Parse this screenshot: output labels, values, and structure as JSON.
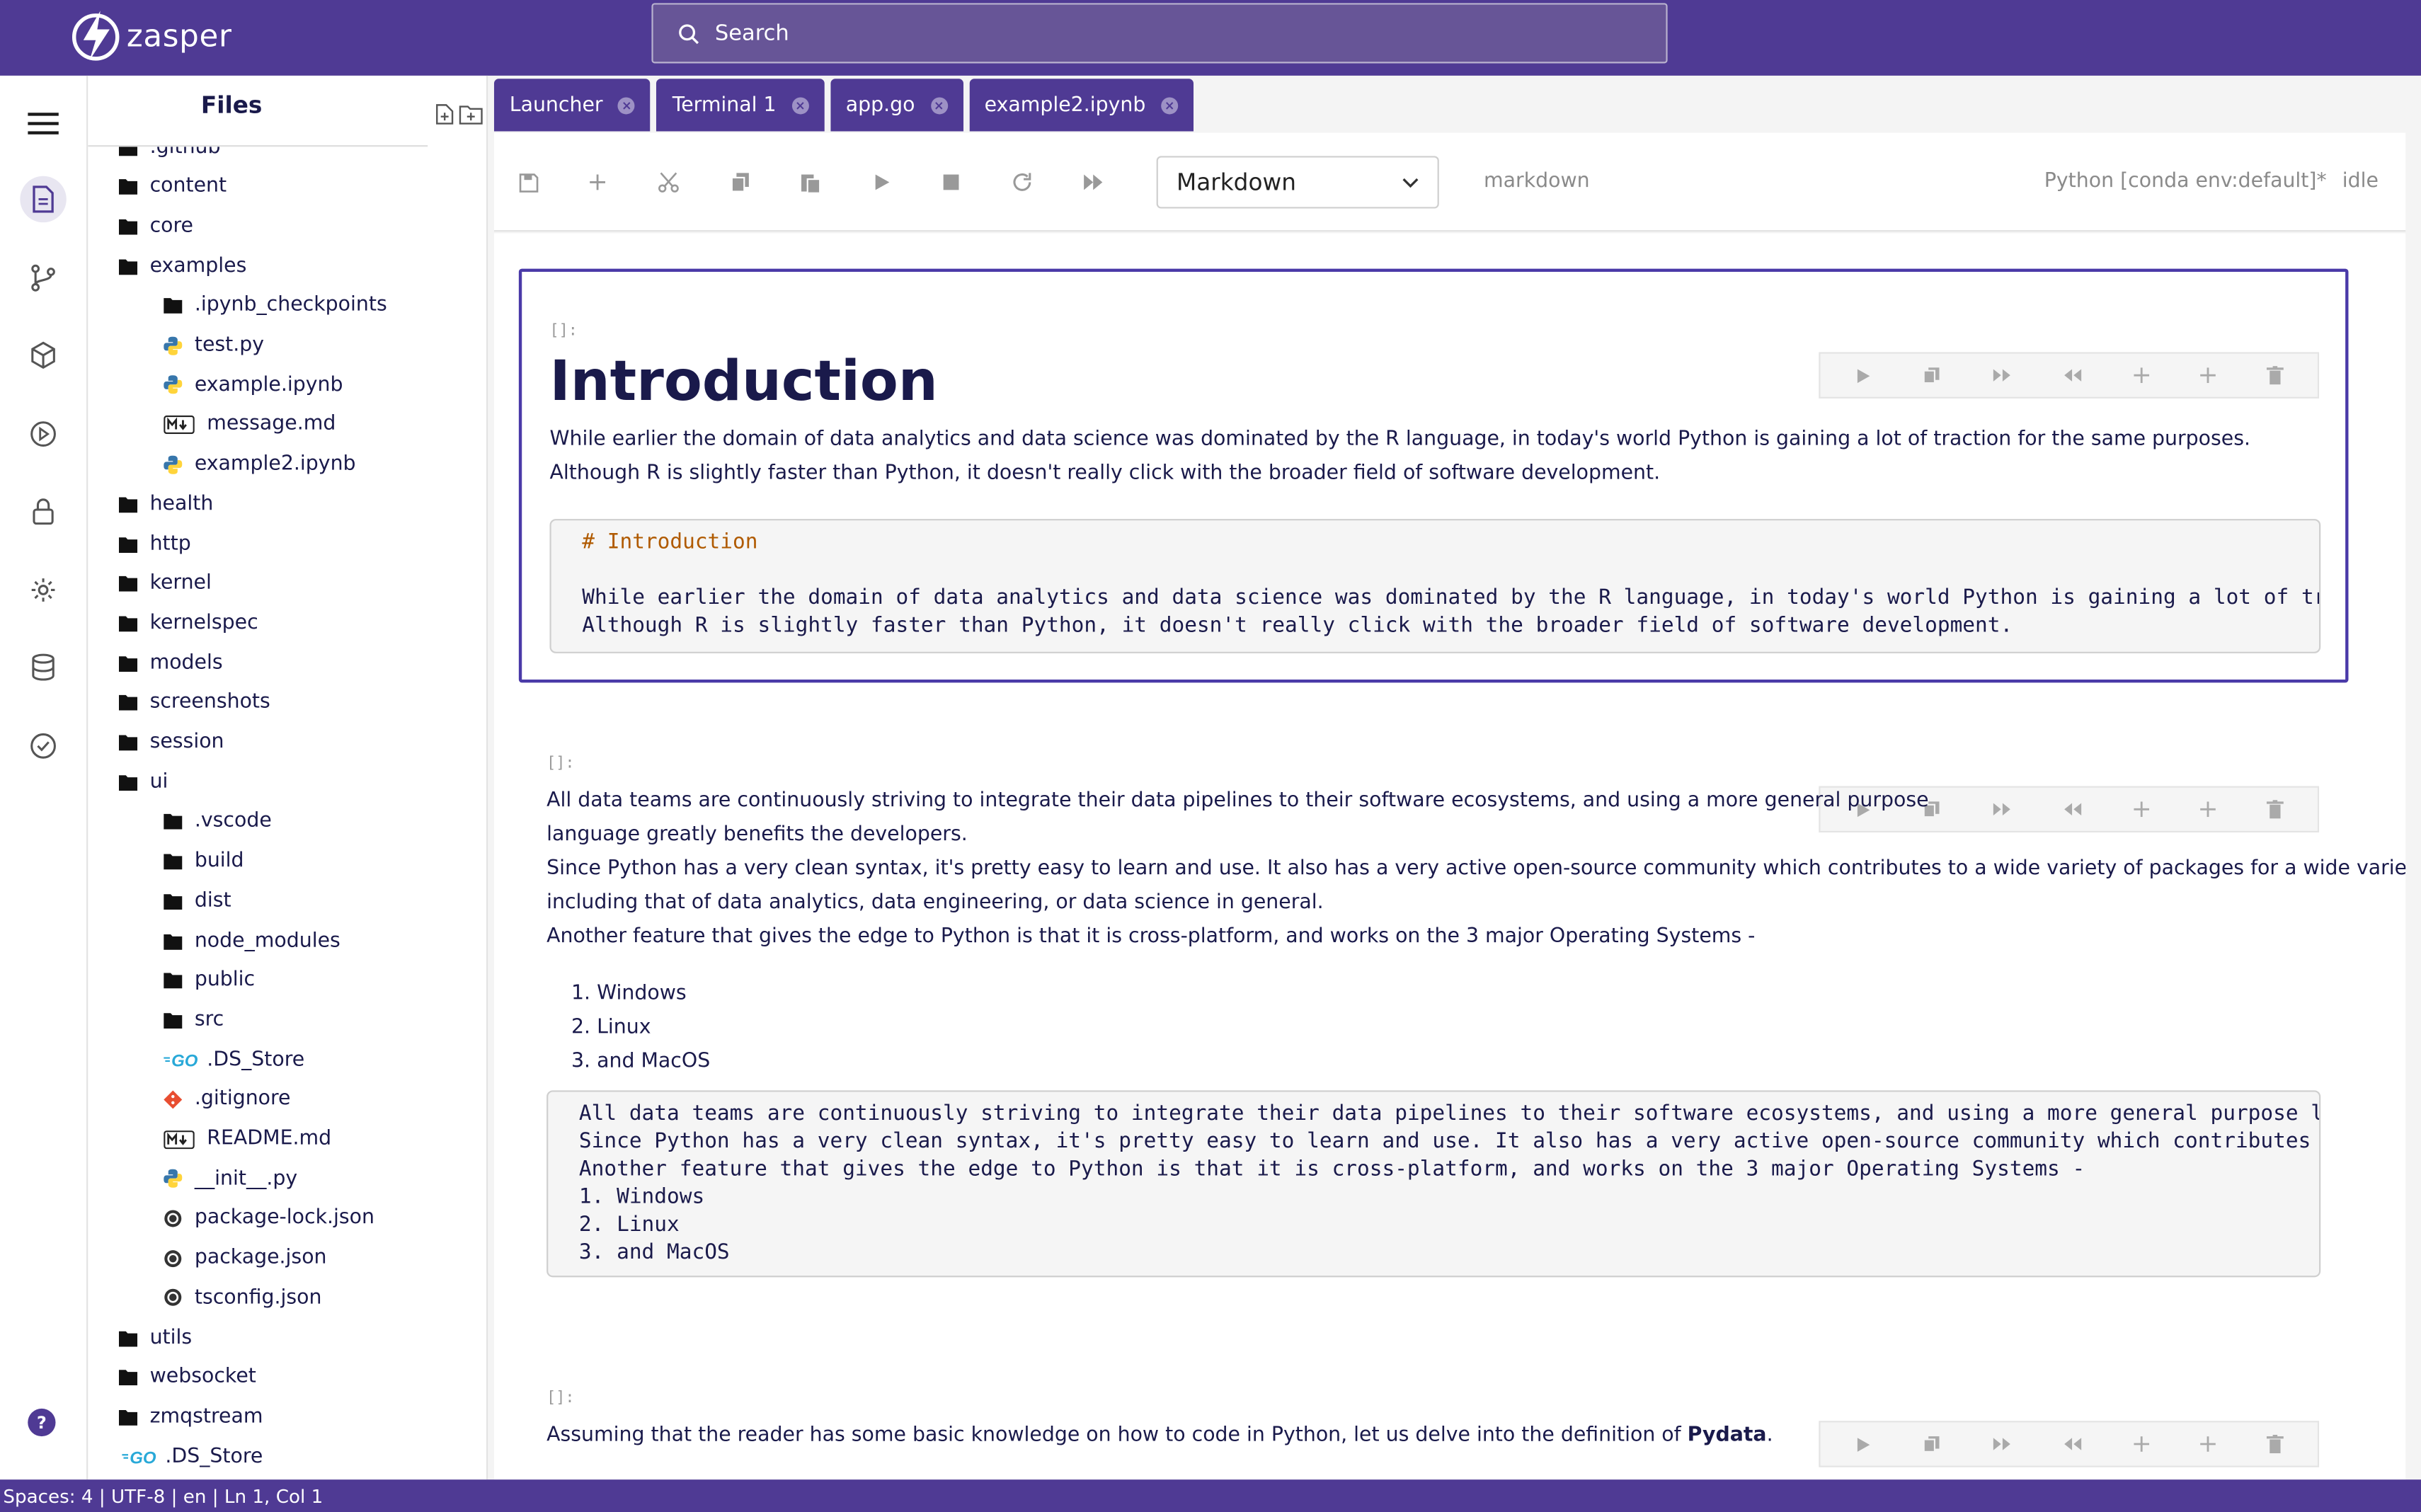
{
  "app": {
    "name": "zasper"
  },
  "search": {
    "placeholder": "Search"
  },
  "sidebar": {
    "title": "Files",
    "items": [
      {
        "label": ".github",
        "icon": "folder-icon",
        "indent": 0
      },
      {
        "label": "content",
        "icon": "folder-icon",
        "indent": 0
      },
      {
        "label": "core",
        "icon": "folder-icon",
        "indent": 0
      },
      {
        "label": "examples",
        "icon": "folder-open-icon",
        "indent": 0
      },
      {
        "label": ".ipynb_checkpoints",
        "icon": "folder-icon",
        "indent": 1
      },
      {
        "label": "test.py",
        "icon": "python-icon",
        "indent": 1
      },
      {
        "label": "example.ipynb",
        "icon": "python-icon",
        "indent": 1
      },
      {
        "label": "message.md",
        "icon": "markdown-icon",
        "indent": 1
      },
      {
        "label": "example2.ipynb",
        "icon": "python-icon",
        "indent": 1
      },
      {
        "label": "health",
        "icon": "folder-icon",
        "indent": 0
      },
      {
        "label": "http",
        "icon": "folder-icon",
        "indent": 0
      },
      {
        "label": "kernel",
        "icon": "folder-icon",
        "indent": 0
      },
      {
        "label": "kernelspec",
        "icon": "folder-icon",
        "indent": 0
      },
      {
        "label": "models",
        "icon": "folder-icon",
        "indent": 0
      },
      {
        "label": "screenshots",
        "icon": "folder-icon",
        "indent": 0
      },
      {
        "label": "session",
        "icon": "folder-icon",
        "indent": 0
      },
      {
        "label": "ui",
        "icon": "folder-open-icon",
        "indent": 0
      },
      {
        "label": ".vscode",
        "icon": "folder-icon",
        "indent": 1
      },
      {
        "label": "build",
        "icon": "folder-icon",
        "indent": 1
      },
      {
        "label": "dist",
        "icon": "folder-icon",
        "indent": 1
      },
      {
        "label": "node_modules",
        "icon": "folder-icon",
        "indent": 1
      },
      {
        "label": "public",
        "icon": "folder-icon",
        "indent": 1
      },
      {
        "label": "src",
        "icon": "folder-icon",
        "indent": 1
      },
      {
        "label": ".DS_Store",
        "icon": "go-icon",
        "indent": 1
      },
      {
        "label": ".gitignore",
        "icon": "git-icon",
        "indent": 1
      },
      {
        "label": "README.md",
        "icon": "markdown-icon",
        "indent": 1
      },
      {
        "label": "__init__.py",
        "icon": "python-icon",
        "indent": 1
      },
      {
        "label": "package-lock.json",
        "icon": "json-icon",
        "indent": 1
      },
      {
        "label": "package.json",
        "icon": "json-icon",
        "indent": 1
      },
      {
        "label": "tsconfig.json",
        "icon": "json-icon",
        "indent": 1
      },
      {
        "label": "utils",
        "icon": "folder-icon",
        "indent": 0
      },
      {
        "label": "websocket",
        "icon": "folder-icon",
        "indent": 0
      },
      {
        "label": "zmqstream",
        "icon": "folder-icon",
        "indent": 0
      },
      {
        "label": ".DS_Store",
        "icon": "go-icon",
        "indent": 0
      }
    ]
  },
  "tabs": [
    {
      "label": "Launcher"
    },
    {
      "label": "Terminal 1"
    },
    {
      "label": "app.go"
    },
    {
      "label": "example2.ipynb"
    }
  ],
  "toolbar": {
    "cell_type": "Markdown",
    "cell_type_hint": "markdown",
    "kernel": "Python [conda env:default]*",
    "kernel_status": "idle"
  },
  "cells": [
    {
      "prompt": "[]:",
      "heading": "Introduction",
      "text": [
        "While earlier the domain of data analytics and data science was dominated by the R language, in today's world Python is gaining a lot of traction for the same purposes.",
        "Although R is slightly faster than Python, it doesn't really click with the broader field of software development."
      ],
      "source": [
        "# Introduction",
        "",
        "While earlier the domain of data analytics and data science was dominated by the R language, in today's world Python is gaining a lot of traction",
        "Although R is slightly faster than Python, it doesn't really click with the broader field of software development."
      ]
    },
    {
      "prompt": "[]:",
      "text": [
        "All data teams are continuously striving to integrate their data pipelines to their software ecosystems, and using a more general purpose",
        "language greatly benefits the developers.",
        "Since Python has a very clean syntax, it's pretty easy to learn and use. It also has a very active open-source community which contributes to a wide variety of packages for a wide variety of tasks,",
        "including that of data analytics, data engineering, or data science in general.",
        "Another feature that gives the edge to Python is that it is cross-platform, and works on the 3 major Operating Systems -"
      ],
      "list": [
        "Windows",
        "Linux",
        "and MacOS"
      ],
      "source": [
        "All data teams are continuously striving to integrate their data pipelines to their software ecosystems, and using a more general purpose language",
        "Since Python has a very clean syntax, it's pretty easy to learn and use. It also has a very active open-source community which contributes to a wi",
        "Another feature that gives the edge to Python is that it is cross-platform, and works on the 3 major Operating Systems -",
        "1. Windows",
        "2. Linux",
        "3. and MacOS"
      ]
    },
    {
      "prompt": "[]:",
      "text_before": "Assuming that the reader has some basic knowledge on how to code in Python, let us delve into the definition of ",
      "text_bold": "Pydata",
      "text_after": "."
    }
  ],
  "statusbar": {
    "text": "Spaces: 4 | UTF-8 | en | Ln 1, Col 1"
  },
  "help": {
    "label": "?"
  },
  "colors": {
    "brand": "#4f3a94",
    "active_cell_border": "#4a3aa8"
  }
}
